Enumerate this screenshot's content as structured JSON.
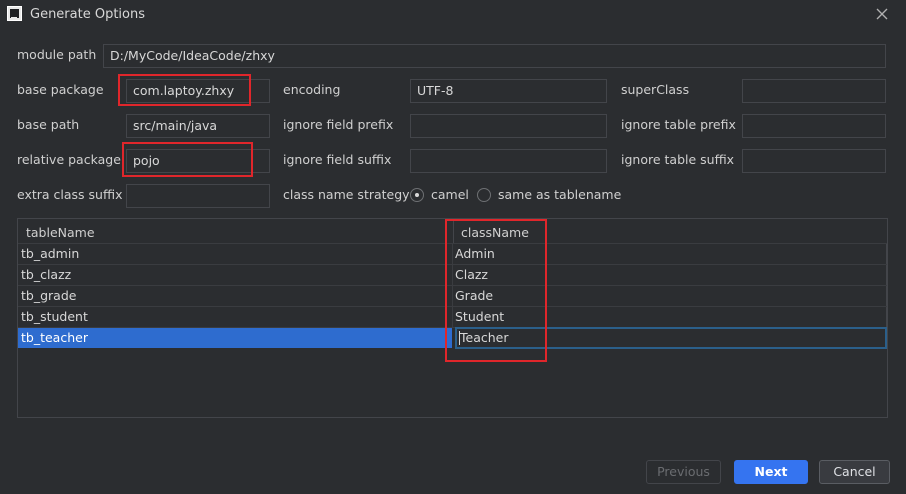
{
  "window": {
    "title": "Generate Options",
    "logo_text": "IJ"
  },
  "fields": {
    "module_path": {
      "label": "module path",
      "value": "D:/MyCode/IdeaCode/zhxy"
    },
    "base_package": {
      "label": "base package",
      "value": "com.laptoy.zhxy"
    },
    "encoding": {
      "label": "encoding",
      "value": "UTF-8"
    },
    "super_class": {
      "label": "superClass",
      "value": ""
    },
    "base_path": {
      "label": "base path",
      "value": "src/main/java"
    },
    "ignore_field_prefix": {
      "label": "ignore field prefix",
      "value": ""
    },
    "ignore_table_prefix": {
      "label": "ignore table prefix",
      "value": ""
    },
    "relative_package": {
      "label": "relative package",
      "value": "pojo"
    },
    "ignore_field_suffix": {
      "label": "ignore field suffix",
      "value": ""
    },
    "ignore_table_suffix": {
      "label": "ignore table suffix",
      "value": ""
    },
    "extra_class_suffix": {
      "label": "extra class suffix",
      "value": ""
    }
  },
  "strategy": {
    "label": "class name strategy",
    "options": [
      "camel",
      "same as tablename"
    ],
    "selected": "camel"
  },
  "table": {
    "headers": [
      "tableName",
      "className"
    ],
    "rows": [
      [
        "tb_admin",
        "Admin"
      ],
      [
        "tb_clazz",
        "Clazz"
      ],
      [
        "tb_grade",
        "Grade"
      ],
      [
        "tb_student",
        "Student"
      ],
      [
        "tb_teacher",
        "Teacher"
      ]
    ],
    "selected_row": 4
  },
  "buttons": {
    "previous": "Previous",
    "next": "Next",
    "cancel": "Cancel"
  },
  "colors": {
    "background": "#2b2d30",
    "accent": "#3574f0",
    "selection": "#2e6ccf",
    "highlight_box": "#e0262b"
  }
}
